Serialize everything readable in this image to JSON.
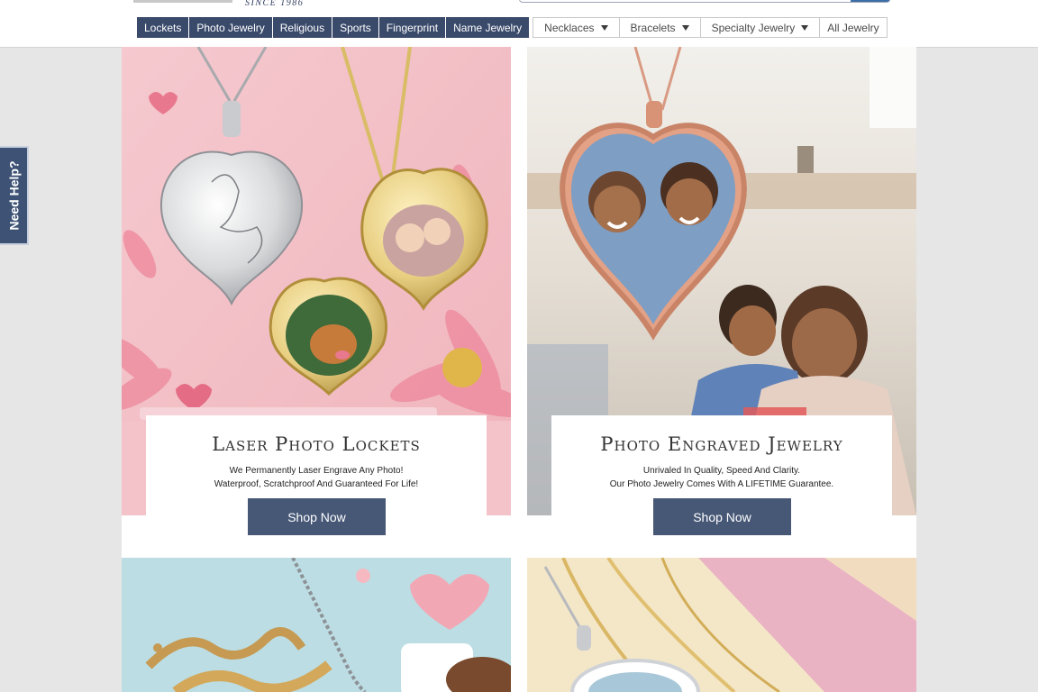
{
  "header": {
    "logo_tagline": "SINCE 1986"
  },
  "nav": {
    "items": [
      {
        "label": "Lockets",
        "dropdown": false
      },
      {
        "label": "Photo Jewelry",
        "dropdown": false
      },
      {
        "label": "Religious",
        "dropdown": false
      },
      {
        "label": "Sports",
        "dropdown": false
      },
      {
        "label": "Fingerprint",
        "dropdown": false
      },
      {
        "label": "Name Jewelry",
        "dropdown": false
      },
      {
        "label": "Necklaces",
        "dropdown": true
      },
      {
        "label": "Bracelets",
        "dropdown": true
      },
      {
        "label": "Specialty Jewelry",
        "dropdown": true
      },
      {
        "label": "All Jewelry",
        "dropdown": false
      }
    ]
  },
  "help_tab": {
    "label": "Need Help?"
  },
  "tiles": [
    {
      "title": "Laser Photo Lockets",
      "line1": "We Permanently Laser Engrave Any Photo!",
      "line2": "Waterproof, Scratchproof And Guaranteed For Life!",
      "button": "Shop Now"
    },
    {
      "title": "Photo Engraved Jewelry",
      "line1": "Unrivaled In Quality, Speed And Clarity.",
      "line2": "Our Photo Jewelry Comes With A LIFETIME Guarantee.",
      "button": "Shop Now"
    }
  ],
  "colors": {
    "nav_dark": "#3a4a6b",
    "button": "#475877",
    "help_tab": "#3d5275"
  }
}
